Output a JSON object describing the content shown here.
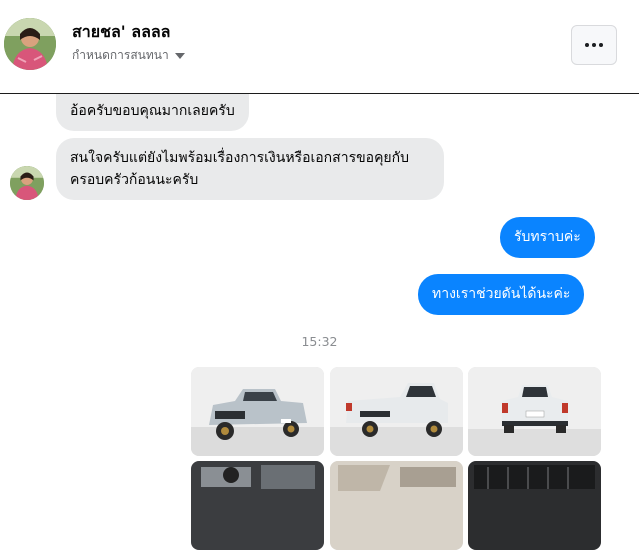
{
  "header": {
    "contact_name": "สายชล' ลลลล",
    "conversation_settings_label": "กำหนดการสนทนา",
    "more_icon": "more-horizontal-icon"
  },
  "messages": [
    {
      "direction": "incoming",
      "text": "อ้อครับขอบคุณมากเลยครับ"
    },
    {
      "direction": "incoming",
      "text": "สนใจครับแต่ยังไมพร้อมเรื่องการเงินหรือเอกสารขอคุยกับครอบครัวก้อนนะครับ"
    },
    {
      "direction": "outgoing",
      "text": "รับทราบค่ะ"
    },
    {
      "direction": "outgoing",
      "text": "ทางเราช่วยดันได้นะค่ะ"
    }
  ],
  "timestamp": "15:32",
  "photos": [
    {
      "subject": "silver pickup truck front three-quarter view"
    },
    {
      "subject": "silver pickup truck rear three-quarter view"
    },
    {
      "subject": "silver pickup truck rear view"
    },
    {
      "subject": "engine bay"
    },
    {
      "subject": "door interior panel"
    },
    {
      "subject": "cargo bed liner"
    }
  ],
  "colors": {
    "outgoing_bubble": "#0a84ff",
    "incoming_bubble": "#e9eaeb",
    "secondary_text": "#65676b"
  }
}
